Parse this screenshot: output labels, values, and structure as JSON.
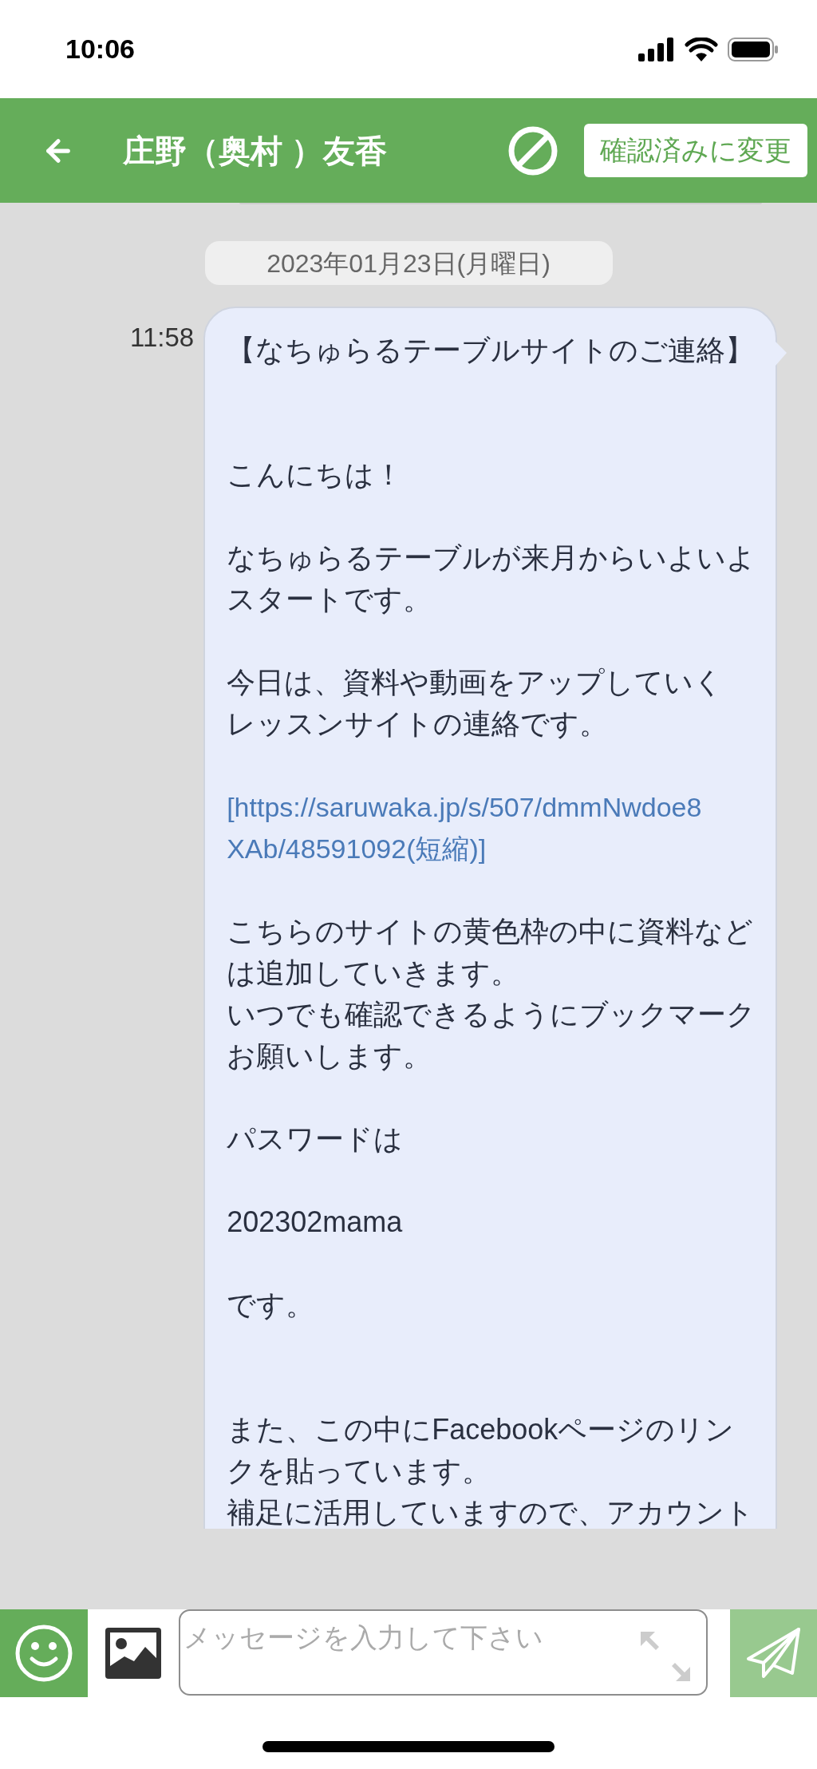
{
  "status_bar": {
    "time": "10:06"
  },
  "header": {
    "title": "庄野（奥村 ）友香",
    "action_button": "確認済みに変更"
  },
  "chat": {
    "date": "2023年01月23日(月曜日)",
    "messages": [
      {
        "time": "11:58",
        "paragraphs": [
          {
            "kind": "text",
            "lines": [
              "【なちゅらるテーブルサイトのご連絡】"
            ]
          },
          {
            "kind": "spaced_text",
            "lines": [
              "こんにちは！"
            ]
          },
          {
            "kind": "text",
            "lines": [
              "なちゅらるテーブルが来月からいよいよ",
              "スタートです。"
            ]
          },
          {
            "kind": "text",
            "lines": [
              "今日は、資料や動画をアップしていく",
              "レッスンサイトの連絡です。"
            ]
          },
          {
            "kind": "link",
            "lines": [
              "[https://saruwaka.jp/s/507/dmmNwdoe8",
              "XAb/48591092(短縮)]"
            ]
          },
          {
            "kind": "text",
            "lines": [
              "こちらのサイトの黄色枠の中に資料など",
              "は追加していきます。",
              "いつでも確認できるようにブックマーク",
              "お願いします。"
            ]
          },
          {
            "kind": "text",
            "lines": [
              "パスワードは"
            ]
          },
          {
            "kind": "text",
            "lines": [
              "202302mama"
            ]
          },
          {
            "kind": "text",
            "lines": [
              "です。"
            ]
          },
          {
            "kind": "spaced_text",
            "lines": [
              "また、この中にFacebookページのリン",
              "クを貼っています。",
              "補足に活用していますので、アカウント"
            ]
          }
        ]
      }
    ]
  },
  "composer": {
    "placeholder": "メッセージを入力して下さい"
  }
}
